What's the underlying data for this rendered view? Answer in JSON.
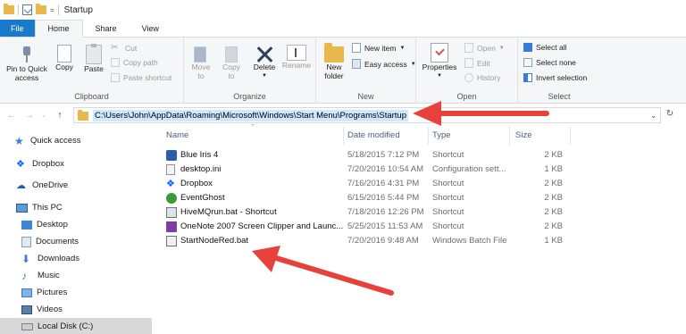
{
  "window": {
    "title": "Startup",
    "quick_access_dropdown": "="
  },
  "tabs": [
    {
      "label": "File"
    },
    {
      "label": "Home"
    },
    {
      "label": "Share"
    },
    {
      "label": "View"
    }
  ],
  "ribbon": {
    "clipboard": {
      "label": "Clipboard",
      "pin_label_1": "Pin to Quick",
      "pin_label_2": "access",
      "copy": "Copy",
      "paste": "Paste",
      "cut": "Cut",
      "copy_path": "Copy path",
      "paste_shortcut": "Paste shortcut"
    },
    "organize": {
      "label": "Organize",
      "move_to_1": "Move",
      "move_to_2": "to",
      "copy_to_1": "Copy",
      "copy_to_2": "to",
      "delete": "Delete",
      "rename": "Rename"
    },
    "new": {
      "label": "New",
      "new_folder_1": "New",
      "new_folder_2": "folder",
      "new_item": "New item",
      "easy_access": "Easy access"
    },
    "open": {
      "label": "Open",
      "properties": "Properties",
      "open": "Open",
      "edit": "Edit",
      "history": "History"
    },
    "select": {
      "label": "Select",
      "select_all": "Select all",
      "select_none": "Select none",
      "invert_selection": "Invert selection"
    }
  },
  "address": {
    "path": "C:\\Users\\John\\AppData\\Roaming\\Microsoft\\Windows\\Start Menu\\Programs\\Startup"
  },
  "nav_pane": {
    "items": [
      {
        "label": "Quick access",
        "icon": "star-icon"
      },
      {
        "label": "Dropbox",
        "icon": "dropbox-icon"
      },
      {
        "label": "OneDrive",
        "icon": "onedrive-icon"
      },
      {
        "label": "This PC",
        "icon": "computer-icon"
      },
      {
        "label": "Desktop",
        "icon": "desktop-folder-icon"
      },
      {
        "label": "Documents",
        "icon": "documents-folder-icon"
      },
      {
        "label": "Downloads",
        "icon": "downloads-folder-icon"
      },
      {
        "label": "Music",
        "icon": "music-icon"
      },
      {
        "label": "Pictures",
        "icon": "pictures-folder-icon"
      },
      {
        "label": "Videos",
        "icon": "videos-folder-icon"
      },
      {
        "label": "Local Disk (C:)",
        "icon": "disk-icon"
      }
    ]
  },
  "columns": {
    "name": "Name",
    "date": "Date modified",
    "type": "Type",
    "size": "Size"
  },
  "files": [
    {
      "name": "Blue Iris 4",
      "date": "5/18/2015 7:12 PM",
      "type": "Shortcut",
      "size": "2 KB",
      "icon": "blue-iris-icon"
    },
    {
      "name": "desktop.ini",
      "date": "7/20/2016 10:54 AM",
      "type": "Configuration sett...",
      "size": "1 KB",
      "icon": "ini-file-icon"
    },
    {
      "name": "Dropbox",
      "date": "7/16/2016 4:31 PM",
      "type": "Shortcut",
      "size": "2 KB",
      "icon": "dropbox-icon"
    },
    {
      "name": "EventGhost",
      "date": "6/15/2016 5:44 PM",
      "type": "Shortcut",
      "size": "2 KB",
      "icon": "eventghost-icon"
    },
    {
      "name": "HiveMQrun.bat - Shortcut",
      "date": "7/18/2016 12:26 PM",
      "type": "Shortcut",
      "size": "2 KB",
      "icon": "batch-shortcut-icon"
    },
    {
      "name": "OneNote 2007 Screen Clipper and Launc...",
      "date": "5/25/2015 11:53 AM",
      "type": "Shortcut",
      "size": "2 KB",
      "icon": "onenote-icon"
    },
    {
      "name": "StartNodeRed.bat",
      "date": "7/20/2016 9:48 AM",
      "type": "Windows Batch File",
      "size": "1 KB",
      "icon": "batch-file-icon"
    }
  ],
  "colors": {
    "file_tab": "#1979ca",
    "arrow": "#e8403a",
    "selection": "#cde8ff"
  }
}
